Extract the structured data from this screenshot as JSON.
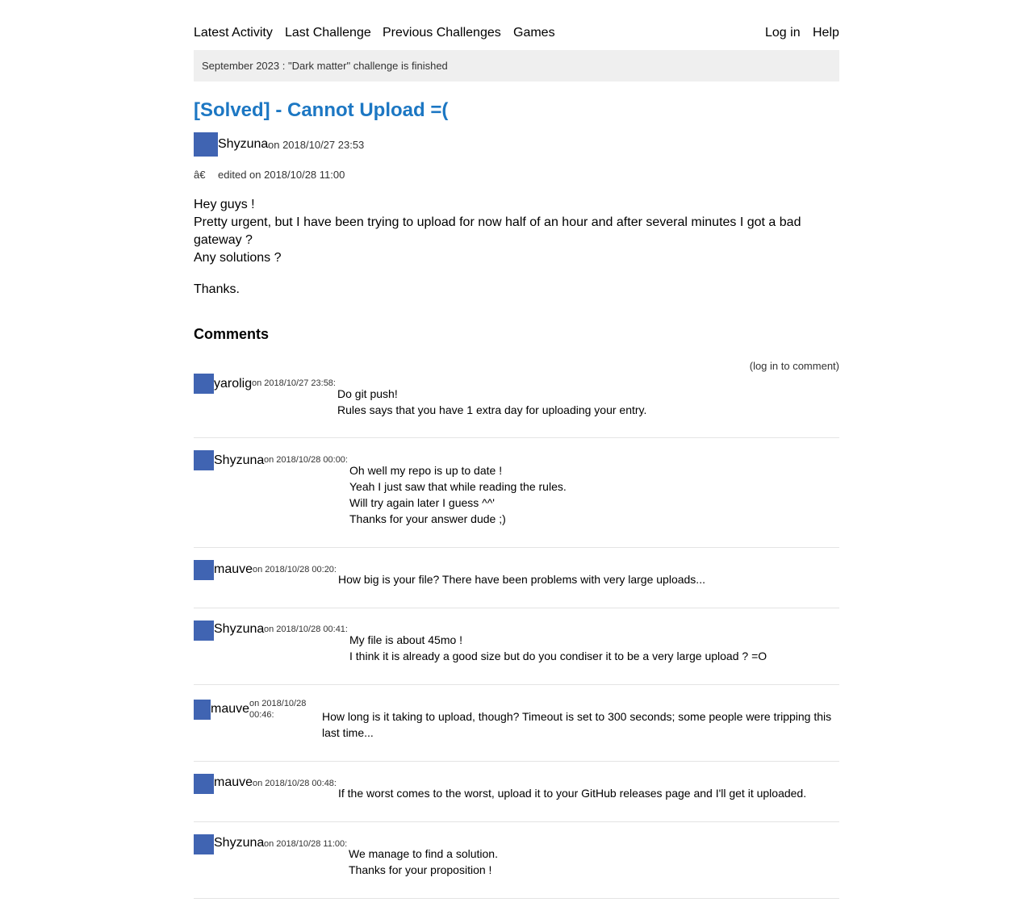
{
  "nav": {
    "latest_activity": "Latest Activity",
    "last_challenge": "Last Challenge",
    "previous_challenges": "Previous Challenges",
    "games": "Games",
    "log_in": "Log in",
    "help": "Help"
  },
  "banner": {
    "text": "September 2023 : \"Dark matter\" challenge is finished"
  },
  "post": {
    "title": "[Solved] - Cannot Upload =(",
    "author": "Shyzuna",
    "date": "on 2018/10/27 23:53",
    "edit_glyph": "â€",
    "edited": "edited on 2018/10/28 11:00",
    "body": [
      "Hey guys !",
      "Pretty urgent, but I have been trying to upload for now half of an hour and after several minutes I got a bad gateway ?",
      "Any solutions ?"
    ],
    "closing": "Thanks."
  },
  "comments_section": {
    "heading": "Comments",
    "login_prompt": "(log in to comment)"
  },
  "comments": [
    {
      "author": "yarolig",
      "date": "on 2018/10/27 23:58:",
      "lines": [
        "Do git push!",
        "Rules says that you have 1 extra day for uploading your entry."
      ]
    },
    {
      "author": "Shyzuna",
      "date": "on 2018/10/28 00:00:",
      "lines": [
        "Oh well my repo is up to date !",
        "Yeah I just saw that while reading the rules.",
        "Will try again later I guess ^^'",
        "Thanks for your answer dude ;)"
      ]
    },
    {
      "author": "mauve",
      "date": "on 2018/10/28 00:20:",
      "lines": [
        "How big is your file? There have been problems with very large uploads..."
      ]
    },
    {
      "author": "Shyzuna",
      "date": "on 2018/10/28 00:41:",
      "lines": [
        "My file is about 45mo !",
        "I think it is already a good size but do you condiser it to be a very large upload ? =O"
      ]
    },
    {
      "author": "mauve",
      "date": "on 2018/10/28 00:46:",
      "lines": [
        "How long is it taking to upload, though? Timeout is set to 300 seconds; some people were tripping this last time..."
      ]
    },
    {
      "author": "mauve",
      "date": "on 2018/10/28 00:48:",
      "lines": [
        "If the worst comes to the worst, upload it to your GitHub releases page and I'll get it uploaded."
      ]
    },
    {
      "author": "Shyzuna",
      "date": "on 2018/10/28 11:00:",
      "lines": [
        "We manage to find a solution.",
        "Thanks for your proposition !"
      ]
    }
  ],
  "colors": {
    "link_title": "#1c77c3",
    "avatar": "#4064b2",
    "banner_bg": "#efefef"
  }
}
